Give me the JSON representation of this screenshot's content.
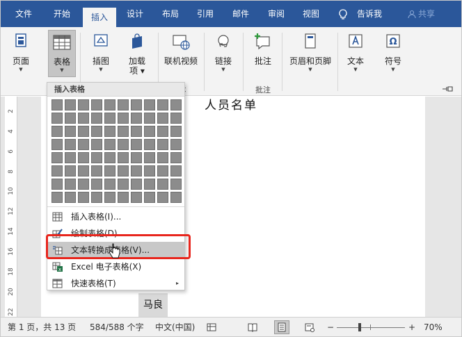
{
  "tabs": {
    "file": "文件",
    "home": "开始",
    "insert": "插入",
    "design": "设计",
    "layout": "布局",
    "references": "引用",
    "mailings": "邮件",
    "review": "审阅",
    "view": "视图",
    "tell_me": "告诉我",
    "share": "共享"
  },
  "ribbon": {
    "pages": "页面",
    "table": "表格",
    "illustrations": "插图",
    "addins_line1": "加载",
    "addins_line2": "项",
    "online_video": "联机视频",
    "links": "链接",
    "comment": "批注",
    "header_footer": "页眉和页脚",
    "text": "文本",
    "symbol": "符号",
    "group_media_tail": "本",
    "group_comments": "批注",
    "collapse": "ㅁ"
  },
  "dropdown": {
    "header": "插入表格",
    "grid_cols": 10,
    "grid_rows": 8,
    "items": [
      {
        "label": "插入表格(I)...",
        "icon": "table-grid-icon"
      },
      {
        "label": "绘制表格(D)",
        "icon": "draw-table-icon"
      },
      {
        "label": "文本转换成表格(V)...",
        "icon": "convert-text-to-table-icon"
      },
      {
        "label": "Excel 电子表格(X)",
        "icon": "excel-icon"
      },
      {
        "label": "快速表格(T)",
        "icon": "quick-table-icon",
        "submenu": "▸"
      }
    ]
  },
  "document": {
    "title": "人员名单",
    "cell_text": "马良"
  },
  "ruler": [
    "2",
    "4",
    "6",
    "8",
    "10",
    "12",
    "14",
    "16",
    "18",
    "20",
    "22"
  ],
  "status": {
    "page": "第 1 页，共 13 页",
    "words": "584/588 个字",
    "language": "中文(中国)",
    "zoom_minus": "−",
    "zoom_plus": "+",
    "zoom": "70%"
  },
  "colors": {
    "accent": "#2b579a",
    "highlight_box": "#e8261d"
  }
}
